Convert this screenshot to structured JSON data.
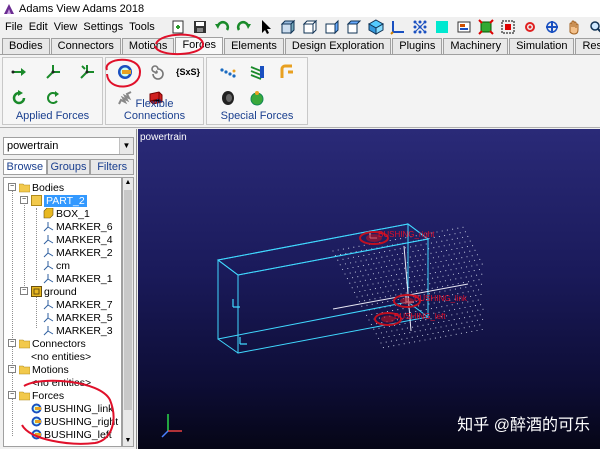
{
  "window": {
    "title": "Adams View Adams 2018"
  },
  "menu": [
    "File",
    "Edit",
    "View",
    "Settings",
    "Tools"
  ],
  "toolbar_icons": [
    "new-icon",
    "save-icon",
    "undo-icon",
    "redo-icon",
    "select-arrow-icon",
    "box-view-icon",
    "front-view-icon",
    "side-view-icon",
    "iso-view-icon",
    "axes-icon",
    "grid-icon",
    "render-icon",
    "color-icon",
    "fit-icon",
    "zoom-box-icon",
    "center-icon",
    "rotate-icon",
    "pan-hand-icon",
    "zoom-icon"
  ],
  "tabs": [
    {
      "label": "Bodies"
    },
    {
      "label": "Connectors"
    },
    {
      "label": "Motions"
    },
    {
      "label": "Forces",
      "active": true
    },
    {
      "label": "Elements"
    },
    {
      "label": "Design Exploration"
    },
    {
      "label": "Plugins"
    },
    {
      "label": "Machinery"
    },
    {
      "label": "Simulation"
    },
    {
      "label": "Results"
    }
  ],
  "ribbon": {
    "groups": [
      {
        "label": "Applied Forces"
      },
      {
        "label": "Flexible Connections"
      },
      {
        "label": "Special Forces"
      }
    ],
    "sxs_label": "{SxS}"
  },
  "browser": {
    "model": "powertrain",
    "subtabs": [
      "Browse",
      "Groups",
      "Filters"
    ],
    "tree": {
      "bodies": "Bodies",
      "part2": "PART_2",
      "box1": "BOX_1",
      "marker6": "MARKER_6",
      "marker4": "MARKER_4",
      "marker2": "MARKER_2",
      "cm": "cm",
      "marker1": "MARKER_1",
      "ground": "ground",
      "marker7": "MARKER_7",
      "marker5": "MARKER_5",
      "marker3": "MARKER_3",
      "connectors": "Connectors",
      "connectors_none": "<no entities>",
      "motions": "Motions",
      "motions_none": "<no entities>",
      "forces": "Forces",
      "bushing_link": "BUSHING_link",
      "bushing_right": "BUSHING_right",
      "bushing_left": "BUSHING_left"
    }
  },
  "viewport": {
    "model_label": "powertrain",
    "annotations": {
      "bushing_right": "BUSHING_right",
      "bushing_link": "BUSHING_link",
      "bushing_left": "BUSHING_left"
    },
    "watermark": "知乎 @醉酒的可乐"
  },
  "colors": {
    "highlight_red": "#e0102a",
    "wire_cyan": "#40d8ff",
    "selection_blue": "#3399ff",
    "ribbon_label_blue": "#1a3f8f"
  }
}
